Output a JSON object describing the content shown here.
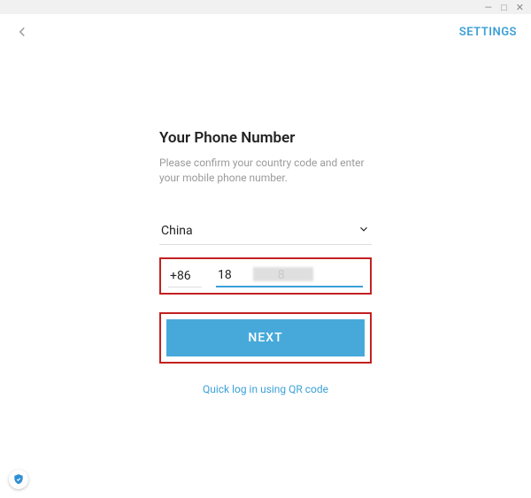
{
  "window": {
    "minimize": "—",
    "maximize": "□",
    "close": "✕"
  },
  "header": {
    "settings": "SETTINGS"
  },
  "form": {
    "title": "Your Phone Number",
    "subtitle": "Please confirm your country code and enter your mobile phone number.",
    "country": "China",
    "country_code": "+86",
    "phone_value": "18               8",
    "next_label": "NEXT",
    "qr_link": "Quick log in using QR code"
  }
}
